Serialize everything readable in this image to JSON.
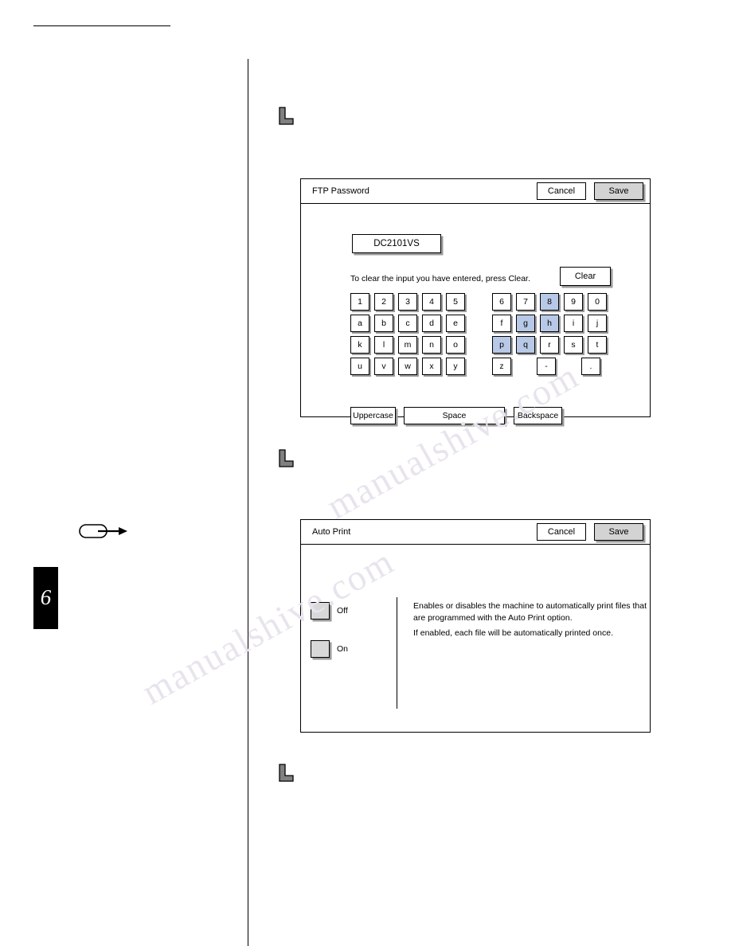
{
  "page": {
    "chapter_number": "6"
  },
  "watermark": {
    "line1": "manualshive.com",
    "line2": "manualshive.com"
  },
  "step_icons": [
    {
      "name": "step-marker-1"
    },
    {
      "name": "step-marker-2"
    },
    {
      "name": "step-marker-3"
    }
  ],
  "note_marker": {
    "name": "note-arrow"
  },
  "ftp_password_panel": {
    "title": "FTP Password",
    "cancel_label": "Cancel",
    "save_label": "Save",
    "field_value": "DC2101VS",
    "hint": "To clear the input you have entered, press Clear.",
    "clear_label": "Clear",
    "keys_left": [
      [
        "1",
        "2",
        "3",
        "4",
        "5"
      ],
      [
        "a",
        "b",
        "c",
        "d",
        "e"
      ],
      [
        "k",
        "l",
        "m",
        "n",
        "o"
      ],
      [
        "u",
        "v",
        "w",
        "x",
        "y"
      ]
    ],
    "keys_right": [
      [
        "6",
        "7",
        "8",
        "9",
        "0"
      ],
      [
        "f",
        "g",
        "h",
        "i",
        "j"
      ],
      [
        "p",
        "q",
        "r",
        "s",
        "t"
      ],
      [
        "z",
        "",
        "-",
        "",
        "."
      ]
    ],
    "selected_keys": [
      "8",
      "g",
      "h",
      "p",
      "q"
    ],
    "uppercase_label": "Uppercase",
    "space_label": "Space",
    "backspace_label": "Backspace"
  },
  "auto_print_panel": {
    "title": "Auto Print",
    "cancel_label": "Cancel",
    "save_label": "Save",
    "options": [
      {
        "label": "Off"
      },
      {
        "label": "On"
      }
    ],
    "description_1": "Enables or disables the machine to automatically print files that are programmed with the Auto Print option.",
    "description_2": "If enabled, each file will be automatically printed once."
  }
}
